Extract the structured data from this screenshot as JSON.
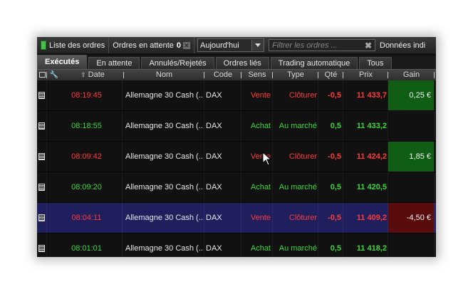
{
  "toolbar": {
    "orders_list": "Liste des ordres",
    "pending": "Ordres en attente",
    "pending_count": "0",
    "period": "Aujourd'hui",
    "filter_placeholder": "Filtrer les ordres ...",
    "data_label": "Données indi"
  },
  "tabs": [
    {
      "label": "Exécutés",
      "active": true
    },
    {
      "label": "En attente",
      "active": false
    },
    {
      "label": "Annulés/Rejetés",
      "active": false
    },
    {
      "label": "Ordres liés",
      "active": false
    },
    {
      "label": "Trading automatique",
      "active": false
    },
    {
      "label": "Tous",
      "active": false
    }
  ],
  "columns": {
    "date": "Date",
    "nom": "Nom",
    "code": "Code",
    "sens": "Sens",
    "type": "Type",
    "qte": "Qté",
    "prix": "Prix",
    "gain": "Gain"
  },
  "rows": [
    {
      "time": "08:19:45",
      "name": "Allemagne 30 Cash (...",
      "code": "DAX",
      "side": "Vente",
      "type": "Clôturer",
      "qty": "-0,5",
      "price": "11 433,7",
      "gain": "0,25 €",
      "dir": "sell",
      "gain_sign": "pos",
      "selected": false
    },
    {
      "time": "08:18:55",
      "name": "Allemagne 30 Cash (...",
      "code": "DAX",
      "side": "Achat",
      "type": "Au marché",
      "qty": "0,5",
      "price": "11 433,2",
      "gain": "",
      "dir": "buy",
      "gain_sign": "none",
      "selected": false
    },
    {
      "time": "08:09:42",
      "name": "Allemagne 30 Cash (...",
      "code": "DAX",
      "side": "Vente",
      "type": "Clôturer",
      "qty": "-0,5",
      "price": "11 424,2",
      "gain": "1,85 €",
      "dir": "sell",
      "gain_sign": "pos",
      "selected": false
    },
    {
      "time": "08:09:20",
      "name": "Allemagne 30 Cash (...",
      "code": "DAX",
      "side": "Achat",
      "type": "Au marché",
      "qty": "0,5",
      "price": "11 420,5",
      "gain": "",
      "dir": "buy",
      "gain_sign": "none",
      "selected": false
    },
    {
      "time": "08:04:11",
      "name": "Allemagne 30 Cash (...",
      "code": "DAX",
      "side": "Vente",
      "type": "Clôturer",
      "qty": "-0,5",
      "price": "11 409,2",
      "gain": "-4,50 €",
      "dir": "sell",
      "gain_sign": "neg",
      "selected": true
    },
    {
      "time": "08:01:01",
      "name": "Allemagne 30 Cash (...",
      "code": "DAX",
      "side": "Achat",
      "type": "Au marché",
      "qty": "0,5",
      "price": "11 418,2",
      "gain": "",
      "dir": "buy",
      "gain_sign": "none",
      "selected": false
    }
  ]
}
